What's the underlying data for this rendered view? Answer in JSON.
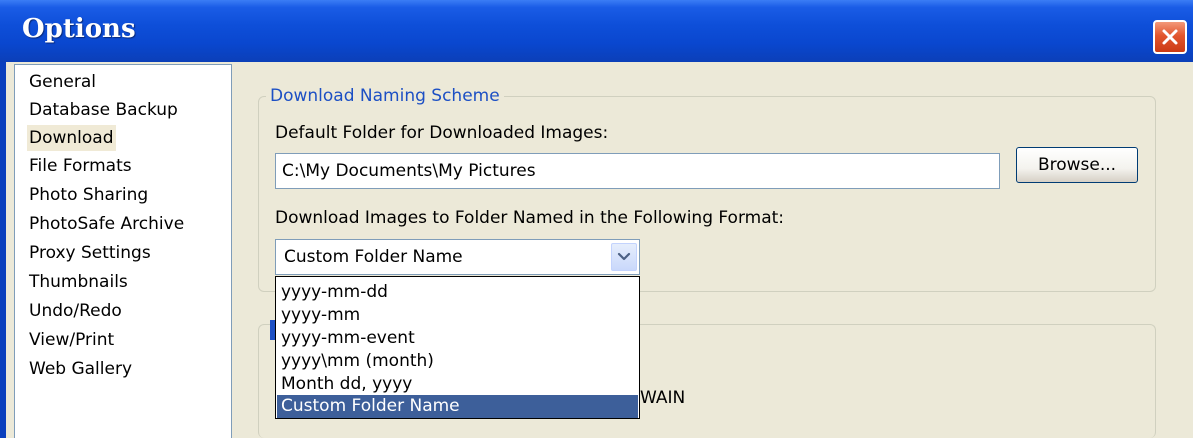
{
  "window": {
    "title": "Options",
    "close_icon": "close-icon",
    "accent_color": "#0a47cf"
  },
  "nav": {
    "items": [
      {
        "label": "General",
        "selected": false
      },
      {
        "label": "Database Backup",
        "selected": false
      },
      {
        "label": "Download",
        "selected": true
      },
      {
        "label": "File Formats",
        "selected": false
      },
      {
        "label": "Photo Sharing",
        "selected": false
      },
      {
        "label": "PhotoSafe Archive",
        "selected": false
      },
      {
        "label": "Proxy Settings",
        "selected": false
      },
      {
        "label": "Thumbnails",
        "selected": false
      },
      {
        "label": "Undo/Redo",
        "selected": false
      },
      {
        "label": "View/Print",
        "selected": false
      },
      {
        "label": "Web Gallery",
        "selected": false
      }
    ]
  },
  "naming_scheme": {
    "legend": "Download Naming Scheme",
    "default_folder_label": "Default Folder for Downloaded Images:",
    "default_folder_value": "C:\\My Documents\\My Pictures",
    "browse_label": "Browse...",
    "format_label": "Download Images to Folder Named in the Following Format:",
    "format_selected": "Custom Folder Name",
    "format_options": [
      "yyyy-mm-dd",
      "yyyy-mm",
      "yyyy-mm-event",
      "yyyy\\mm (month)",
      "Month dd, yyyy",
      "Custom Folder Name"
    ],
    "selected_option_index": 5,
    "selected_color": "#3d5f9a"
  },
  "second_group": {
    "partial_text": "WAIN"
  }
}
